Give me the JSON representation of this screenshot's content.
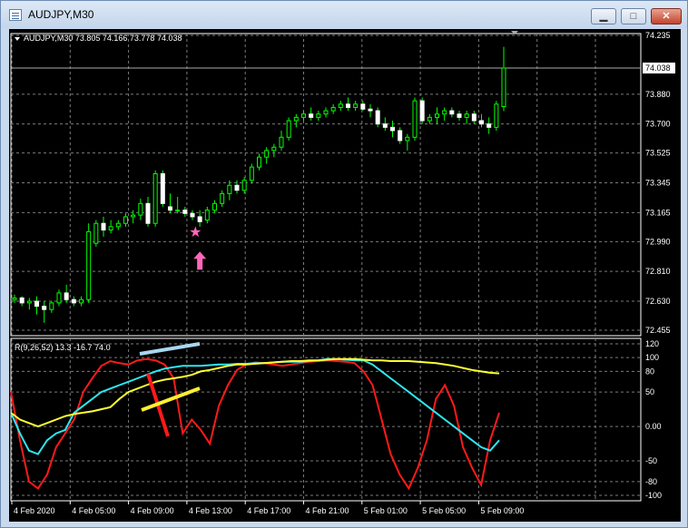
{
  "window": {
    "title": "AUDJPY,M30",
    "icon": "chart-window-icon",
    "buttons": {
      "minimize": "minimize-icon",
      "maximize": "maximize-icon",
      "close": "close-icon"
    }
  },
  "price_panel": {
    "label": "AUDJPY,M30  73.805 74.166 73.778 74.038",
    "current_price": "74.038",
    "y_ticks": [
      "74.235",
      "74.038",
      "73.880",
      "73.700",
      "73.525",
      "73.345",
      "73.165",
      "72.990",
      "72.810",
      "72.630",
      "72.455"
    ]
  },
  "indicator_panel": {
    "label": "R(9,26,52) 13.3 -16.7 74.0",
    "y_ticks": [
      "120",
      "100",
      "80",
      "50",
      "0.00",
      "-50",
      "-80",
      "-100"
    ]
  },
  "time_axis": {
    "labels": [
      "4 Feb 2020",
      "4 Feb 05:00",
      "4 Feb 09:00",
      "4 Feb 13:00",
      "4 Feb 17:00",
      "4 Feb 21:00",
      "5 Feb 01:00",
      "5 Feb 05:00",
      "5 Feb 09:00"
    ]
  },
  "colors": {
    "bull": "#00ff00",
    "bear": "#ffffff",
    "grid": "#7b7b7b",
    "r_fast": "#ff1a1a",
    "r_mid": "#2ee6f0",
    "r_slow": "#ffff33",
    "marker_star": "#ff66bb",
    "marker_arrow": "#ff66bb",
    "drawn_line_1": "#a8d8f0",
    "drawn_line_2": "#ff1a1a",
    "drawn_line_3": "#ffee33"
  },
  "chart_data": {
    "type": "candlestick",
    "symbol": "AUDJPY",
    "timeframe": "M30",
    "candles": [
      [
        72.64,
        72.67,
        72.62,
        72.65
      ],
      [
        72.65,
        72.66,
        72.6,
        72.62
      ],
      [
        72.62,
        72.65,
        72.58,
        72.63
      ],
      [
        72.63,
        72.66,
        72.55,
        72.6
      ],
      [
        72.6,
        72.63,
        72.5,
        72.58
      ],
      [
        72.58,
        72.63,
        72.56,
        72.62
      ],
      [
        72.62,
        72.7,
        72.6,
        72.68
      ],
      [
        72.68,
        72.73,
        72.62,
        72.64
      ],
      [
        72.64,
        72.66,
        72.6,
        72.62
      ],
      [
        72.62,
        72.66,
        72.6,
        72.64
      ],
      [
        72.64,
        73.1,
        72.62,
        73.05
      ],
      [
        72.98,
        73.12,
        72.96,
        73.1
      ],
      [
        73.1,
        73.14,
        73.02,
        73.06
      ],
      [
        73.06,
        73.12,
        73.04,
        73.08
      ],
      [
        73.08,
        73.12,
        73.06,
        73.1
      ],
      [
        73.1,
        73.16,
        73.08,
        73.14
      ],
      [
        73.14,
        73.18,
        73.1,
        73.15
      ],
      [
        73.15,
        73.25,
        73.12,
        73.22
      ],
      [
        73.22,
        73.26,
        73.08,
        73.1
      ],
      [
        73.1,
        73.42,
        73.08,
        73.4
      ],
      [
        73.4,
        73.42,
        73.2,
        73.22
      ],
      [
        73.2,
        73.28,
        73.16,
        73.18
      ],
      [
        73.18,
        73.26,
        73.16,
        73.18
      ],
      [
        73.18,
        73.2,
        73.14,
        73.16
      ],
      [
        73.16,
        73.18,
        73.12,
        73.14
      ],
      [
        73.14,
        73.18,
        73.08,
        73.11
      ],
      [
        73.12,
        73.2,
        73.1,
        73.18
      ],
      [
        73.18,
        73.24,
        73.16,
        73.22
      ],
      [
        73.22,
        73.3,
        73.2,
        73.28
      ],
      [
        73.28,
        73.36,
        73.24,
        73.33
      ],
      [
        73.33,
        73.36,
        73.28,
        73.3
      ],
      [
        73.3,
        73.38,
        73.28,
        73.36
      ],
      [
        73.36,
        73.46,
        73.34,
        73.44
      ],
      [
        73.44,
        73.52,
        73.42,
        73.5
      ],
      [
        73.5,
        73.56,
        73.46,
        73.54
      ],
      [
        73.54,
        73.58,
        73.5,
        73.56
      ],
      [
        73.56,
        73.66,
        73.54,
        73.62
      ],
      [
        73.62,
        73.74,
        73.6,
        73.72
      ],
      [
        73.72,
        73.76,
        73.68,
        73.74
      ],
      [
        73.74,
        73.78,
        73.72,
        73.76
      ],
      [
        73.76,
        73.8,
        73.72,
        73.74
      ],
      [
        73.74,
        73.78,
        73.72,
        73.76
      ],
      [
        73.76,
        73.8,
        73.74,
        73.78
      ],
      [
        73.78,
        73.82,
        73.76,
        73.8
      ],
      [
        73.8,
        73.84,
        73.78,
        73.82
      ],
      [
        73.82,
        73.86,
        73.78,
        73.8
      ],
      [
        73.8,
        73.84,
        73.78,
        73.82
      ],
      [
        73.82,
        73.84,
        73.78,
        73.79
      ],
      [
        73.79,
        73.82,
        73.74,
        73.78
      ],
      [
        73.78,
        73.8,
        73.68,
        73.7
      ],
      [
        73.7,
        73.74,
        73.66,
        73.68
      ],
      [
        73.68,
        73.72,
        73.62,
        73.66
      ],
      [
        73.66,
        73.68,
        73.58,
        73.6
      ],
      [
        73.6,
        73.64,
        73.54,
        73.62
      ],
      [
        73.62,
        73.86,
        73.6,
        73.84
      ],
      [
        73.84,
        73.86,
        73.7,
        73.72
      ],
      [
        73.72,
        73.76,
        73.7,
        73.74
      ],
      [
        73.74,
        73.8,
        73.7,
        73.76
      ],
      [
        73.76,
        73.8,
        73.72,
        73.78
      ],
      [
        73.78,
        73.8,
        73.74,
        73.76
      ],
      [
        73.76,
        73.78,
        73.72,
        73.74
      ],
      [
        73.74,
        73.78,
        73.7,
        73.76
      ],
      [
        73.76,
        73.78,
        73.7,
        73.72
      ],
      [
        73.72,
        73.76,
        73.68,
        73.7
      ],
      [
        73.7,
        73.74,
        73.64,
        73.68
      ],
      [
        73.68,
        73.84,
        73.66,
        73.82
      ],
      [
        73.805,
        74.166,
        73.778,
        74.038
      ]
    ],
    "ylim": [
      72.455,
      74.235
    ],
    "indicator": {
      "name": "R(9,26,52)",
      "values_shown": [
        "13.3",
        "-16.7",
        "74.0"
      ],
      "ylim": [
        -100,
        120
      ],
      "series": [
        {
          "values": [
            50,
            -20,
            -80,
            -90,
            -70,
            -30,
            -10,
            10,
            50,
            70,
            88,
            95,
            92,
            90,
            96,
            98,
            96,
            90,
            70,
            -10,
            10,
            -5,
            -25,
            30,
            60,
            82,
            90,
            93,
            92,
            90,
            88,
            90,
            92,
            94,
            95,
            96,
            95,
            94,
            92,
            80,
            60,
            10,
            -40,
            -70,
            -90,
            -60,
            -20,
            40,
            60,
            30,
            -30,
            -60,
            -85,
            -20,
            20
          ]
        },
        {
          "values": [
            20,
            -10,
            -35,
            -40,
            -20,
            -10,
            -5,
            20,
            30,
            40,
            50,
            55,
            60,
            65,
            70,
            75,
            80,
            84,
            86,
            88,
            88,
            88,
            89,
            90,
            90,
            91,
            91,
            92,
            92,
            93,
            94,
            94,
            94,
            95,
            96,
            98,
            98,
            97,
            96,
            96,
            90,
            80,
            70,
            60,
            50,
            40,
            30,
            20,
            10,
            0,
            -10,
            -20,
            -30,
            -35,
            -20
          ]
        },
        {
          "values": [
            20,
            10,
            5,
            0,
            5,
            10,
            15,
            18,
            20,
            22,
            25,
            28,
            40,
            50,
            55,
            60,
            65,
            68,
            70,
            72,
            75,
            80,
            82,
            85,
            88,
            90,
            90,
            91,
            92,
            93,
            94,
            95,
            95,
            96,
            96,
            97,
            98,
            98,
            98,
            97,
            96,
            96,
            95,
            95,
            95,
            94,
            93,
            92,
            90,
            88,
            85,
            82,
            80,
            78,
            77
          ]
        }
      ]
    }
  }
}
